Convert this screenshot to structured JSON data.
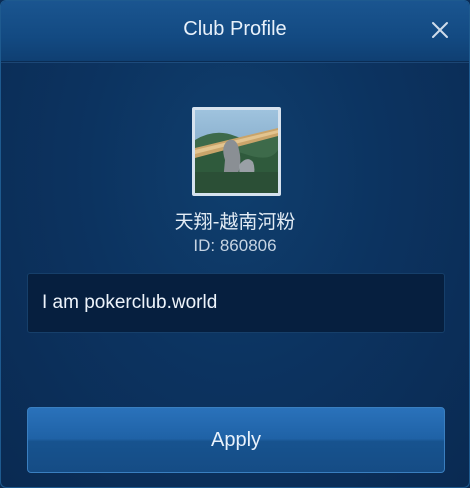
{
  "dialog": {
    "title": "Club Profile",
    "close_icon": "close-icon"
  },
  "club": {
    "name": "天翔-越南河粉",
    "id_text": "ID: 860806",
    "avatar_icon": "club-avatar-image"
  },
  "description": {
    "value": "I am pokerclub.world"
  },
  "actions": {
    "apply_label": "Apply"
  },
  "colors": {
    "header": "#134a82",
    "background": "#0c3360",
    "button": "#1f62a6",
    "text": "#e8f1fb"
  }
}
